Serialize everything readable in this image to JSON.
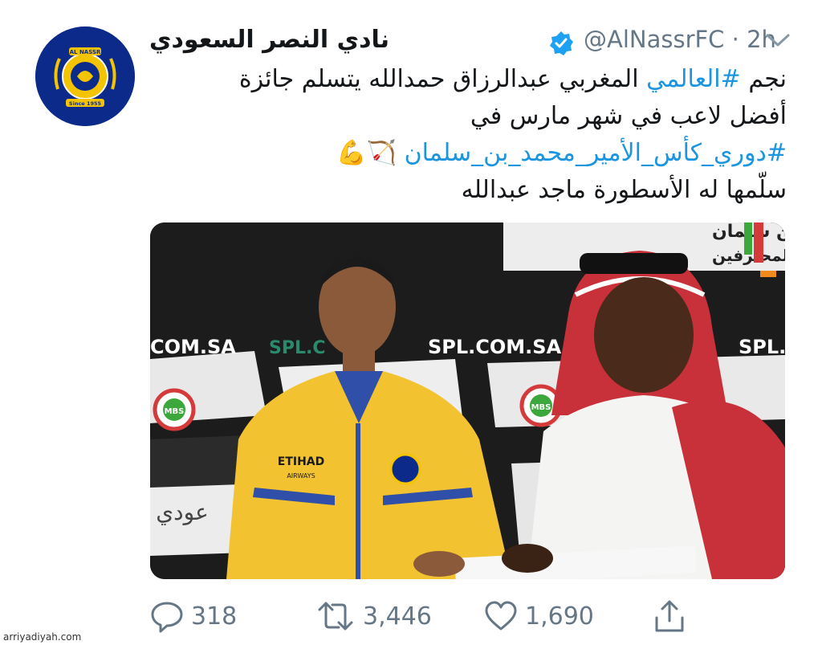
{
  "account": {
    "name": "نادي النصر السعودي",
    "handle": "@AlNassrFC",
    "separator": "·",
    "time": "2h"
  },
  "avatar": {
    "icon": "al-nassr-crest-icon",
    "crest_text_top": "AL NASSR",
    "crest_text_bottom": "Since 1955",
    "brand_color": "#0b2a8a",
    "accent_color": "#f5c400"
  },
  "tweet": {
    "line1_hashtag": "#العالمي",
    "line1_prefix": "نجم ",
    "line1_suffix": " المغربي عبدالرزاق حمدالله يتسلم جائزة",
    "line2": "أفضل لاعب في شهر مارس في",
    "line3_hashtag": "#دوري_كأس_الأمير_محمد_بن_سلمان",
    "line3_emoji": "🏹💪",
    "line4": "سلّمها له الأسطورة ماجد عبدالله"
  },
  "photo": {
    "banner_top": "الأمير محمد بن سلمان",
    "banner_top2": "للمحترفين",
    "sponsor_left": "COM.SA",
    "sponsor_mid1": "SPL.C",
    "sponsor_mid2": "SPL.COM.SA",
    "sponsor_right": "SPL.C",
    "logo_label": "MBS",
    "jersey_sponsor": "ETIHAD",
    "jersey_sponsor_sub": "AIRWAYS",
    "left_text": "عودي",
    "colors": {
      "jacket": "#f2c230",
      "thobe": "#f4f4f2",
      "shemagh": "#c8313a",
      "backdrop": "#1c1c1c"
    }
  },
  "actions": {
    "reply_count": "318",
    "retweet_count": "3,446",
    "like_count": "1,690"
  },
  "watermark": "arriyadiyah.com"
}
